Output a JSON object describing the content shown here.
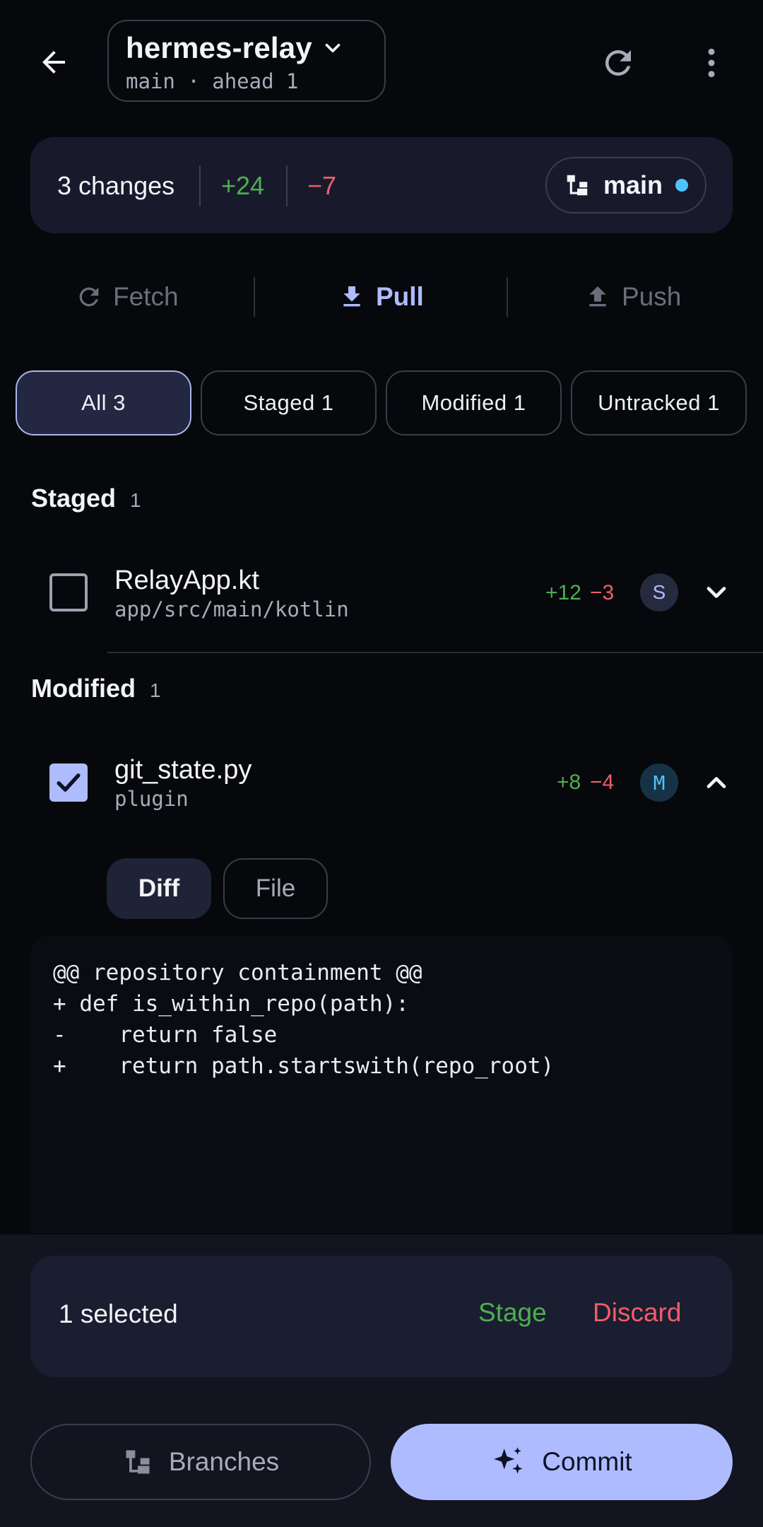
{
  "header": {
    "repo_name": "hermes-relay",
    "branch": "main",
    "separator": "·",
    "ahead": "ahead 1"
  },
  "summary": {
    "changes": "3 changes",
    "additions": "+24",
    "deletions": "−7",
    "branch": "main"
  },
  "sync": {
    "fetch": "Fetch",
    "pull": "Pull",
    "push": "Push"
  },
  "filters": [
    {
      "label": "All 3",
      "selected": true
    },
    {
      "label": "Staged 1",
      "selected": false
    },
    {
      "label": "Modified 1",
      "selected": false
    },
    {
      "label": "Untracked 1",
      "selected": false
    }
  ],
  "sections": {
    "staged": {
      "title": "Staged",
      "count": "1",
      "file": {
        "name": "RelayApp.kt",
        "path": "app/src/main/kotlin",
        "additions": "+12",
        "deletions": "−3",
        "badge": "S",
        "checked": false
      }
    },
    "modified": {
      "title": "Modified",
      "count": "1",
      "file": {
        "name": "git_state.py",
        "path": "plugin",
        "additions": "+8",
        "deletions": "−4",
        "badge": "M",
        "checked": true
      }
    }
  },
  "viewer": {
    "diff_tab": "Diff",
    "file_tab": "File",
    "lines": [
      "@@ repository containment @@",
      "+ def is_within_repo(path):",
      "-    return false",
      "+    return path.startswith(repo_root)"
    ]
  },
  "selection": {
    "count": "1 selected",
    "stage": "Stage",
    "discard": "Discard"
  },
  "actions": {
    "branches": "Branches",
    "commit": "Commit"
  },
  "colors": {
    "background": "#07080c",
    "accent": "#aebcff",
    "added": "#4caf50",
    "deleted": "#ef5e66",
    "branch_dot": "#4fc3f7"
  }
}
